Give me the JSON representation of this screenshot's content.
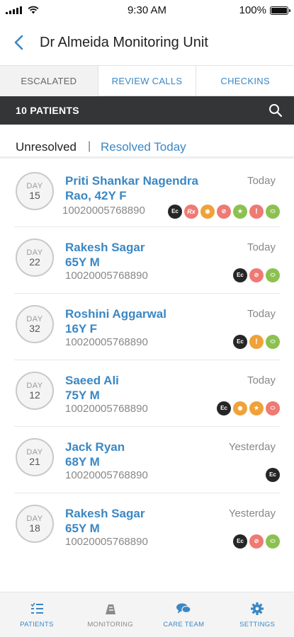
{
  "status_bar": {
    "time": "9:30 AM",
    "battery": "100%",
    "battery_level": 1.0
  },
  "header": {
    "title": "Dr Almeida Monitoring Unit",
    "back_icon": "chevron-left-icon"
  },
  "tabs": [
    {
      "label": "ESCALATED",
      "active": true
    },
    {
      "label": "REVIEW CALLS",
      "active": false
    },
    {
      "label": "CHECKINS",
      "active": false
    }
  ],
  "count_bar": {
    "label": "10 PATIENTS",
    "search_icon": "search-icon"
  },
  "filter": {
    "unresolved": "Unresolved",
    "separator": "|",
    "resolved": "Resolved Today",
    "selected": "Unresolved"
  },
  "patients": [
    {
      "day_label": "DAY",
      "day": "15",
      "name": "Priti Shankar Nagendra Rao, 42Y F",
      "id": "10020005768890",
      "when": "Today",
      "icons": [
        {
          "type": "ec",
          "text": "Ec"
        },
        {
          "type": "rx",
          "text": "Rx"
        },
        {
          "type": "cam",
          "text": "◉"
        },
        {
          "type": "block",
          "text": "⊘"
        },
        {
          "type": "walk",
          "text": "★"
        },
        {
          "type": "alert",
          "text": "!"
        },
        {
          "type": "pill",
          "text": "⬭"
        }
      ]
    },
    {
      "day_label": "DAY",
      "day": "22",
      "name": "Rakesh Sagar 65Y M",
      "id": "10020005768890",
      "when": "Today",
      "icons": [
        {
          "type": "ec",
          "text": "Ec"
        },
        {
          "type": "block",
          "text": "⊘"
        },
        {
          "type": "pill",
          "text": "⬭"
        }
      ]
    },
    {
      "day_label": "DAY",
      "day": "32",
      "name": "Roshini Aggarwal 16Y F",
      "id": "10020005768890",
      "when": "Today",
      "icons": [
        {
          "type": "ec",
          "text": "Ec"
        },
        {
          "type": "alert-o",
          "text": "!"
        },
        {
          "type": "pill",
          "text": "⬭"
        }
      ]
    },
    {
      "day_label": "DAY",
      "day": "12",
      "name": "Saeed Ali 75Y M",
      "id": "10020005768890",
      "when": "Today",
      "icons": [
        {
          "type": "ec",
          "text": "Ec"
        },
        {
          "type": "cam",
          "text": "◉"
        },
        {
          "type": "walk-o",
          "text": "★"
        },
        {
          "type": "pill-r",
          "text": "⬭"
        }
      ]
    },
    {
      "day_label": "DAY",
      "day": "21",
      "name": "Jack Ryan 68Y M",
      "id": "10020005768890",
      "when": "Yesterday",
      "icons": [
        {
          "type": "ec",
          "text": "Ec"
        }
      ]
    },
    {
      "day_label": "DAY",
      "day": "18",
      "name": "Rakesh Sagar 65Y M",
      "id": "10020005768890",
      "when": "Yesterday",
      "icons": [
        {
          "type": "ec",
          "text": "Ec"
        },
        {
          "type": "block",
          "text": "⊘"
        },
        {
          "type": "pill",
          "text": "⬭"
        }
      ]
    }
  ],
  "bottom_nav": [
    {
      "label": "PATIENTS",
      "icon": "patients-list-icon",
      "active": true
    },
    {
      "label": "MONITORING",
      "icon": "monitoring-icon",
      "active": false
    },
    {
      "label": "CARE TEAM",
      "icon": "care-team-icon",
      "active": false
    },
    {
      "label": "SETTINGS",
      "icon": "gear-icon",
      "active": false
    }
  ],
  "colors": {
    "accent": "#3a87c4",
    "dark_bar": "#333537",
    "inactive_nav": "#8a8a8a"
  }
}
